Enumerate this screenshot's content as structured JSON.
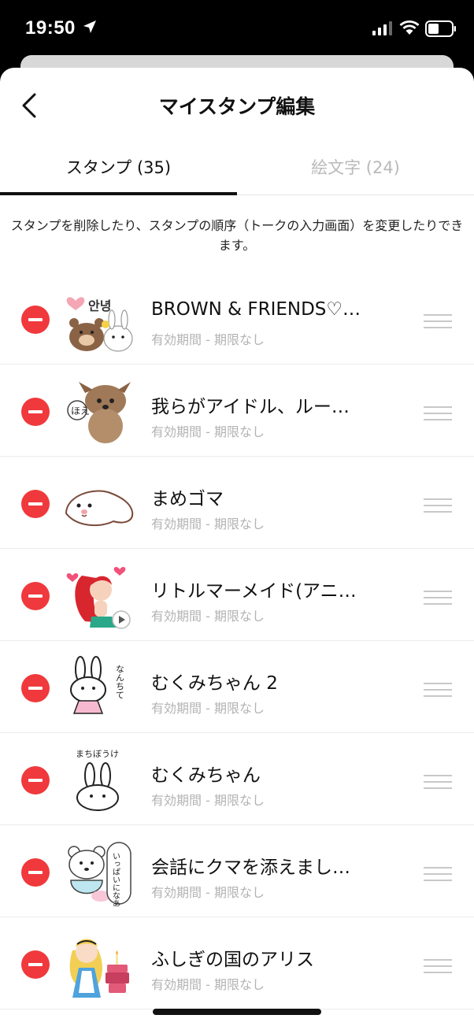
{
  "status_bar": {
    "time": "19:50",
    "icons": [
      "location-arrow-icon",
      "signal-icon",
      "wifi-icon",
      "battery-icon"
    ]
  },
  "header": {
    "back_icon": "chevron-left-icon",
    "title": "マイスタンプ編集"
  },
  "tabs": [
    {
      "label": "スタンプ (35)",
      "active": true
    },
    {
      "label": "絵文字 (24)",
      "active": false
    }
  ],
  "description": "スタンプを削除したり、スタンプの順序（トークの入力画面）を変更したりできます。",
  "colors": {
    "delete": "#f0393c",
    "inactive_tab": "#b9b9b9",
    "subtext": "#b3b3b3"
  },
  "stickers": [
    {
      "title": "BROWN & FRIENDS♡…",
      "subtitle": "有効期間 - 期限なし",
      "thumb": "brown-cony-sticker"
    },
    {
      "title": "我らがアイドル、ルー…",
      "subtitle": "有効期間 - 期限なし",
      "thumb": "puppy-photo-sticker"
    },
    {
      "title": "まめゴマ",
      "subtitle": "有効期間 - 期限なし",
      "thumb": "seal-sticker"
    },
    {
      "title": "リトルマーメイド(アニ…",
      "subtitle": "有効期間 - 期限なし",
      "thumb": "mermaid-sticker",
      "animated": true
    },
    {
      "title": "むくみちゃん 2",
      "subtitle": "有効期間 - 期限なし",
      "thumb": "rabbit-dress-sticker"
    },
    {
      "title": "むくみちゃん",
      "subtitle": "有効期間 - 期限なし",
      "thumb": "rabbit-sticker"
    },
    {
      "title": "会話にクマを添えまし…",
      "subtitle": "有効期間 - 期限なし",
      "thumb": "white-bear-sticker"
    },
    {
      "title": "ふしぎの国のアリス",
      "subtitle": "有効期間 - 期限なし",
      "thumb": "alice-sticker"
    }
  ],
  "stamp_text": {
    "brown": "안녕",
    "puppy": "ほえ",
    "rabbit2": "なんちて",
    "rabbit1": "まちぼうけ",
    "bear": "いっぱいになあえ"
  }
}
